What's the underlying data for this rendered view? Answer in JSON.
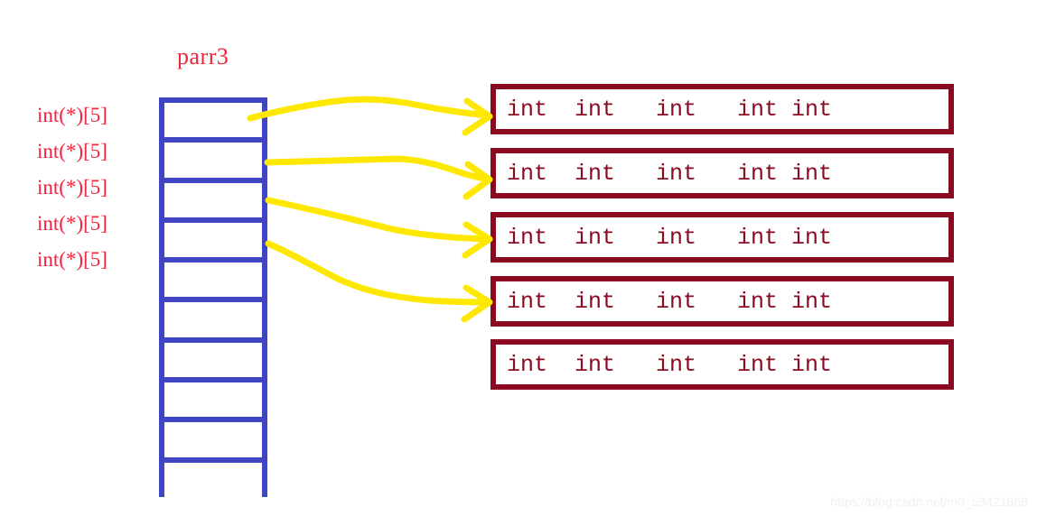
{
  "diagram": {
    "title_label": "parr3",
    "watermark": "https://blog.csdn.net/m0_53421868",
    "colors": {
      "red_text": "#f2253a",
      "blue_box": "#4045c4",
      "maroon_box": "#8a0b21",
      "arrow_yellow": "#ffe800",
      "background": "#ffffff",
      "watermark": "#f0f0f0"
    },
    "pointer_array": {
      "name": "parr3",
      "cell_count": 10,
      "type_labels": [
        "int(*)[5]",
        "int(*)[5]",
        "int(*)[5]",
        "int(*)[5]",
        "int(*)[5]"
      ]
    },
    "int_rows": [
      {
        "text": "int  int   int   int int"
      },
      {
        "text": "int  int   int   int int"
      },
      {
        "text": "int  int   int   int int"
      },
      {
        "text": "int  int   int   int int"
      },
      {
        "text": "int  int   int   int int"
      }
    ],
    "arrows": [
      {
        "label": "pointer-0-to-row-0"
      },
      {
        "label": "pointer-1-to-row-1"
      },
      {
        "label": "pointer-2-to-row-2"
      },
      {
        "label": "pointer-3-to-row-3"
      }
    ]
  }
}
